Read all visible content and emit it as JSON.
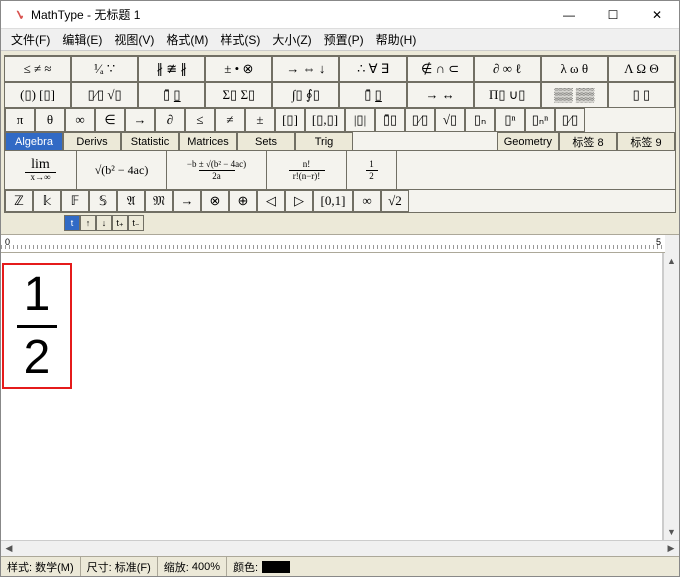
{
  "app": {
    "icon": "mathtype-icon",
    "title": "MathType - 无标题 1"
  },
  "window_controls": {
    "min": "—",
    "max": "☐",
    "close": "✕"
  },
  "menus": [
    {
      "label": "文件(F)"
    },
    {
      "label": "编辑(E)"
    },
    {
      "label": "视图(V)"
    },
    {
      "label": "格式(M)"
    },
    {
      "label": "样式(S)"
    },
    {
      "label": "大小(Z)"
    },
    {
      "label": "预置(P)"
    },
    {
      "label": "帮助(H)"
    }
  ],
  "palette_row1": [
    "≤ ≠ ≈",
    "¹⁄ₐ ∵",
    "∦ ≇ ∦",
    "± • ⊗",
    "→ ⇔ ↓",
    "∴ ∀ ∃",
    "∉ ∩ ⊂",
    "∂ ∞ ℓ",
    "λ ω θ",
    "Λ Ω Θ"
  ],
  "palette_row2": [
    "(▯) [▯]",
    "▯⁄▯  √▯",
    "▯̄  ▯̲",
    "Σ▯ Σ▯",
    "∫▯ ∮▯",
    "▯̄  ▯̲",
    "→  ↔",
    "Π▯ ∪▯",
    "▒▒ ▒▒",
    "▯  ▯"
  ],
  "palette_row3": [
    "π",
    "θ",
    "∞",
    "∈",
    "→",
    "∂",
    "≤",
    "≠",
    "±",
    "[▯]",
    "[▯,▯]",
    "|▯|",
    "▯̄▯",
    "▯⁄▯",
    "√▯",
    "▯ₙ",
    "▯ⁿ",
    "▯ₙⁿ",
    "▯⁄▯"
  ],
  "tabs": [
    {
      "label": "Algebra",
      "active": true
    },
    {
      "label": "Derivs"
    },
    {
      "label": "Statistic"
    },
    {
      "label": "Matrices"
    },
    {
      "label": "Sets"
    },
    {
      "label": "Trig"
    },
    {
      "label": "Geometry"
    },
    {
      "label": "标签 8"
    },
    {
      "label": "标签 9"
    }
  ],
  "previews": {
    "lim_top": "lim",
    "lim_bot": "x→∞",
    "sqrt_expr": "b² − 4ac",
    "quad_top": "−b ± √(b² − 4ac)",
    "quad_bot": "2a",
    "binom_top": "n!",
    "binom_bot": "r!(n−r)!",
    "half_top": "1",
    "half_bot": "2"
  },
  "palette_row5": [
    "ℤ",
    "𝕜",
    "𝔽",
    "𝕊",
    "𝔄",
    "𝔐",
    "→",
    "⊗",
    "⊕",
    "◁",
    "▷",
    "[0,1]",
    "∞",
    "√2"
  ],
  "size_tabs": [
    "t",
    "↑",
    "↓",
    "t₊",
    "t₋"
  ],
  "ruler": {
    "left": "0",
    "right": "5"
  },
  "equation": {
    "numerator": "1",
    "denominator": "2"
  },
  "status": {
    "style_label": "样式:",
    "style_value": "数学(M)",
    "size_label": "尺寸:",
    "size_value": "标准(F)",
    "zoom_label": "缩放:",
    "zoom_value": "400%",
    "color_label": "颜色:",
    "color_value": "#000000"
  }
}
